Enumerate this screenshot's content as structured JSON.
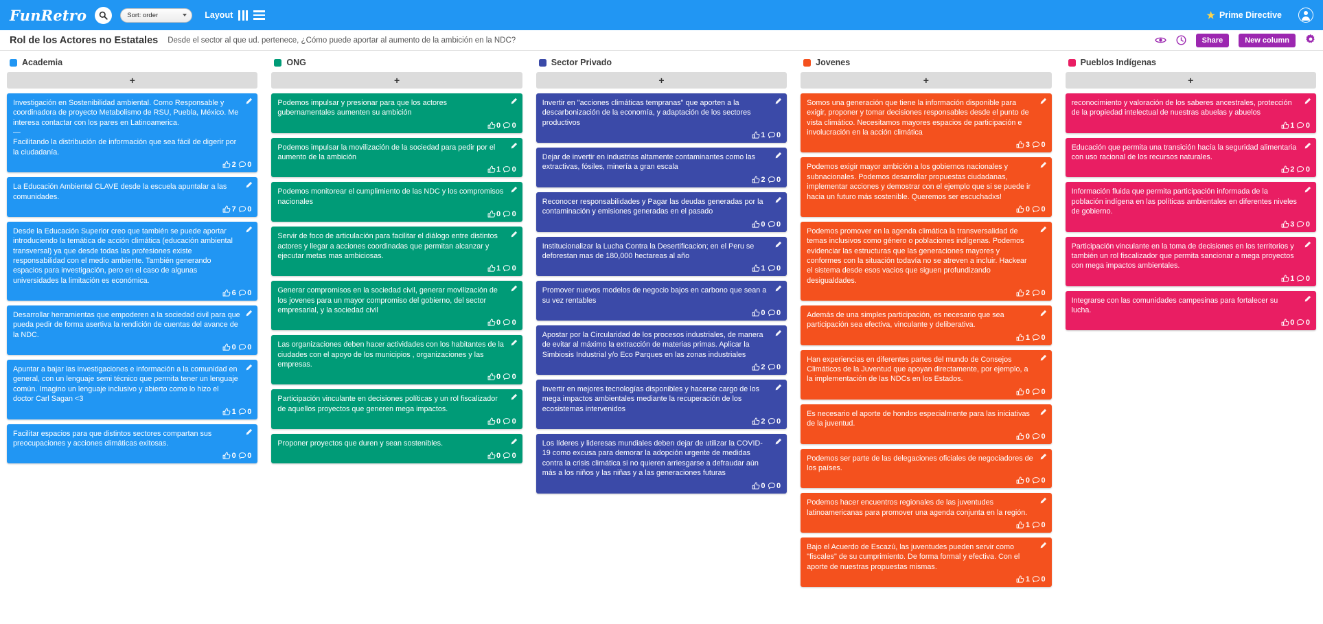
{
  "topbar": {
    "brand": "FunRetro",
    "search_icon": "search-icon",
    "sort_label": "Sort: order",
    "layout_label": "Layout",
    "layout_columns_icon": "columns-layout-icon",
    "layout_rows_icon": "rows-layout-icon",
    "prime_directive": "Prime Directive",
    "star_icon": "star-icon",
    "avatar_icon": "user-avatar-icon"
  },
  "subbar": {
    "title": "Rol de los Actores no Estatales",
    "subtitle": "Desde el sector al que ud. pertenece, ¿Cómo puede aportar al aumento de la ambición en la NDC?",
    "eye_icon": "eye-icon",
    "timer_icon": "timer-icon",
    "share_label": "Share",
    "new_column_label": "New column",
    "settings_icon": "gear-icon",
    "accent": "#9c27b0"
  },
  "add_card_label": "+",
  "columns": [
    {
      "title": "Academia",
      "color": "#2196f3",
      "swatch": "#2196f3",
      "cards": [
        {
          "text": "Investigación en Sostenibilidad ambiental. Como Responsable y coordinadora de proyecto Metabolismo de RSU, Puebla, México. Me interesa contactar con los pares en Latinoamerica.\n—\nFacilitando la distribución de información que sea fácil de digerir por la ciudadanía.",
          "votes": "2",
          "comments": "0"
        },
        {
          "text": "La Educación Ambiental CLAVE desde la escuela apuntalar a las comunidades.",
          "votes": "7",
          "comments": "0"
        },
        {
          "text": "Desde la Educación Superior creo que también se puede aportar introduciendo la temática de acción climática (educación ambiental transversal) ya que desde todas las profesiones existe responsabilidad con el medio ambiente. También generando espacios para investigación, pero en el caso de algunas universidades la limitación es económica.",
          "votes": "6",
          "comments": "0"
        },
        {
          "text": "Desarrollar herramientas que empoderen a la sociedad civil para que pueda pedir de forma asertiva la rendición de cuentas del avance de la NDC.",
          "votes": "0",
          "comments": "0"
        },
        {
          "text": "Apuntar a bajar las investigaciones e información a la comunidad en general, con un lenguaje semi técnico que permita tener un lenguaje común. Imagino un lenguaje inclusivo y abierto como lo hizo el doctor Carl Sagan <3",
          "votes": "1",
          "comments": "0"
        },
        {
          "text": "Facilitar espacios para que distintos sectores compartan sus preocupaciones y acciones climáticas exitosas.",
          "votes": "0",
          "comments": "0"
        }
      ]
    },
    {
      "title": "ONG",
      "color": "#009b77",
      "swatch": "#009b77",
      "cards": [
        {
          "text": "Podemos impulsar y presionar para que los actores gubernamentales aumenten su ambición",
          "votes": "0",
          "comments": "0"
        },
        {
          "text": "Podemos impulsar la movilización de la sociedad para pedir por el aumento de la ambición",
          "votes": "1",
          "comments": "0"
        },
        {
          "text": "Podemos monitorear el cumplimiento de las NDC y los compromisos nacionales",
          "votes": "0",
          "comments": "0"
        },
        {
          "text": "Servir de foco de articulación para facilitar el diálogo entre distintos actores y llegar a acciones coordinadas que permitan alcanzar y ejecutar metas mas ambiciosas.",
          "votes": "1",
          "comments": "0"
        },
        {
          "text": "Generar compromisos en la sociedad civil, generar movilización de los jovenes para un mayor compromiso del gobierno, del sector empresarial, y la sociedad civil",
          "votes": "0",
          "comments": "0"
        },
        {
          "text": "Las organizaciones deben hacer actividades con los habitantes de la ciudades con el apoyo de los municipios , organizaciones y las empresas.",
          "votes": "0",
          "comments": "0"
        },
        {
          "text": "Participación vinculante en decisiones políticas y un rol fiscalizador de aquellos proyectos que generen mega impactos.",
          "votes": "0",
          "comments": "0"
        },
        {
          "text": "Proponer proyectos que duren y sean sostenibles.",
          "votes": "0",
          "comments": "0"
        }
      ]
    },
    {
      "title": "Sector Privado",
      "color": "#3b4aa8",
      "swatch": "#3b4aa8",
      "cards": [
        {
          "text": "Invertir en \"acciones climáticas tempranas\" que aporten a la descarbonización de la economía, y adaptación de los sectores productivos",
          "votes": "1",
          "comments": "0"
        },
        {
          "text": "Dejar de invertir en industrias altamente contaminantes como las extractivas, fósiles, minería a gran escala",
          "votes": "2",
          "comments": "0"
        },
        {
          "text": "Reconocer responsabilidades y Pagar las deudas generadas por la contaminación y emisiones generadas en el pasado",
          "votes": "0",
          "comments": "0"
        },
        {
          "text": "Institucionalizar la Lucha Contra la Desertificacion; en el Peru se deforestan mas de 180,000 hectareas al año",
          "votes": "1",
          "comments": "0"
        },
        {
          "text": "Promover nuevos modelos de negocio bajos en carbono que sean a su vez rentables",
          "votes": "0",
          "comments": "0"
        },
        {
          "text": "Apostar por la Circularidad de los procesos industriales, de manera de evitar al máximo la extracción de materias primas. Aplicar la Simbiosis Industrial y/o Eco Parques en las zonas industriales",
          "votes": "2",
          "comments": "0"
        },
        {
          "text": "Invertir en mejores tecnologías disponibles y hacerse cargo de los mega impactos ambientales mediante la recuperación de los ecosistemas intervenidos",
          "votes": "2",
          "comments": "0"
        },
        {
          "text": "Los líderes y lideresas mundiales deben dejar de utilizar la COVID-19 como excusa para demorar la adopción urgente de medidas contra la crisis climática si no quieren arriesgarse a defraudar aún más a los niños y las niñas y a las generaciones futuras",
          "votes": "0",
          "comments": "0"
        }
      ]
    },
    {
      "title": "Jovenes",
      "color": "#f4511e",
      "swatch": "#f4511e",
      "cards": [
        {
          "text": "Somos una generación que tiene la información disponible para exigir, proponer y tomar decisiones responsables desde el punto de vista climático. Necesitamos mayores espacios de participación e involucración en la acción climática",
          "votes": "3",
          "comments": "0"
        },
        {
          "text": "Podemos exigir mayor ambición a los gobiernos nacionales y subnacionales. Podemos desarrollar propuestas ciudadanas, implementar acciones y demostrar con el ejemplo que si se puede ir hacia un futuro más sostenible. Queremos ser escuchadxs!",
          "votes": "0",
          "comments": "0"
        },
        {
          "text": "Podemos promover en la agenda climática la transversalidad de temas inclusivos como género o poblaciones indígenas. Podemos evidenciar las estructuras que las generaciones mayores y conformes con la situación todavía no se atreven a incluir. Hackear el sistema desde esos vacios que siguen profundizando desigualdades.",
          "votes": "2",
          "comments": "0"
        },
        {
          "text": "Además de una simples participación, es necesario que sea participación sea efectiva, vinculante y deliberativa.",
          "votes": "1",
          "comments": "0"
        },
        {
          "text": "Han experiencias en diferentes partes del mundo de Consejos Climáticos de la Juventud que apoyan directamente, por ejemplo, a la implementación de las NDCs en los Estados.",
          "votes": "0",
          "comments": "0"
        },
        {
          "text": "Es necesario el aporte de hondos especialmente para las iniciativas de la juventud.",
          "votes": "0",
          "comments": "0"
        },
        {
          "text": "Podemos ser parte de las delegaciones oficiales de negociadores de los países.",
          "votes": "0",
          "comments": "0"
        },
        {
          "text": "Podemos hacer encuentros regionales de las juventudes latinoamericanas para promover una agenda conjunta en la región.",
          "votes": "1",
          "comments": "0"
        },
        {
          "text": "Bajo el Acuerdo de Escazú, las juventudes pueden servir como \"fiscales\" de su cumprimiento. De forma formal y efectiva. Con el aporte de nuestras propuestas mismas.",
          "votes": "1",
          "comments": "0"
        }
      ]
    },
    {
      "title": "Pueblos Indígenas",
      "color": "#e91e63",
      "swatch": "#e91e63",
      "cards": [
        {
          "text": "reconocimiento y valoración de los saberes ancestrales, protección de la propiedad intelectual de nuestras abuelas y abuelos",
          "votes": "1",
          "comments": "0"
        },
        {
          "text": "Educación que permita una transición hacía la seguridad alimentaria con uso racional de los recursos naturales.",
          "votes": "2",
          "comments": "0"
        },
        {
          "text": "Información fluida que permita participación informada de la población indígena en las políticas ambientales en diferentes niveles de gobierno.",
          "votes": "3",
          "comments": "0"
        },
        {
          "text": "Participación vinculante en la toma de decisiones en los territorios y también un rol fiscalizador que permita sancionar a mega proyectos con mega impactos ambientales.",
          "votes": "1",
          "comments": "0"
        },
        {
          "text": "Integrarse con las comunidades campesinas para fortalecer su lucha.",
          "votes": "0",
          "comments": "0"
        }
      ]
    }
  ]
}
